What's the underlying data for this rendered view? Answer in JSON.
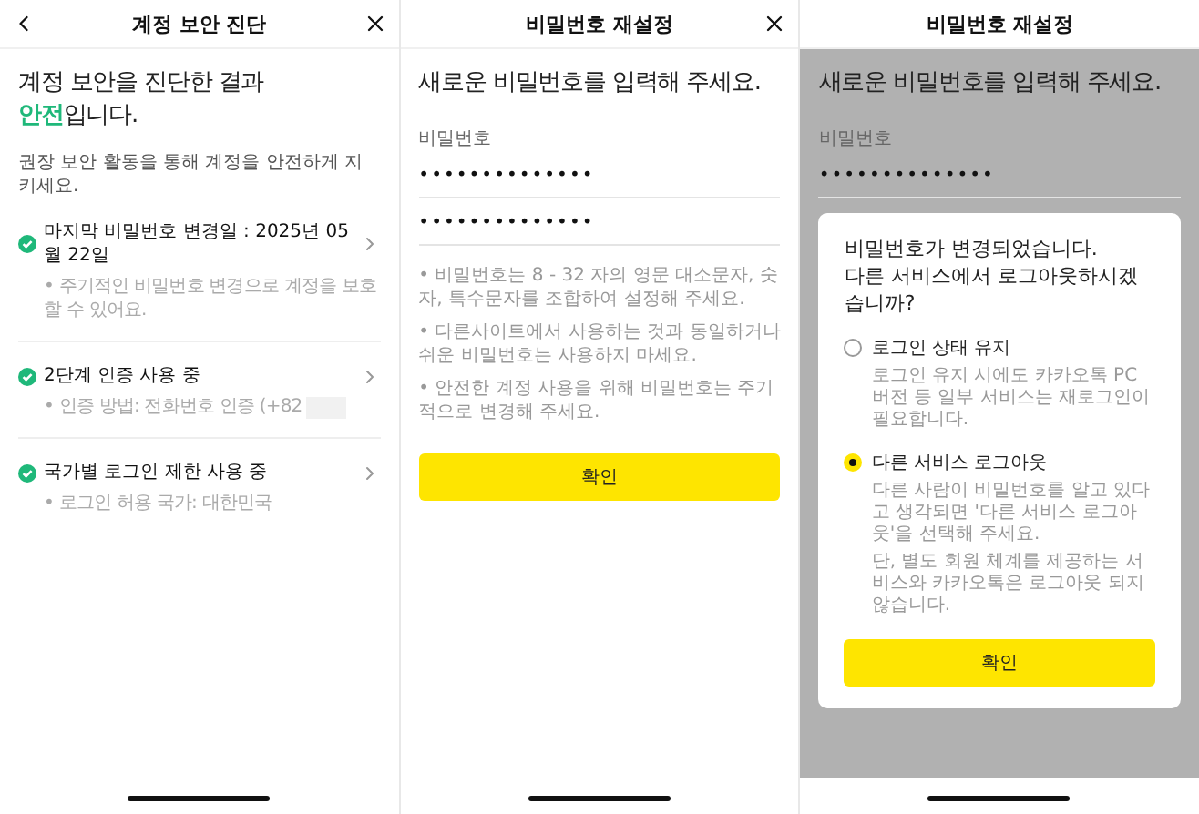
{
  "screens": [
    {
      "kind": "diagnosis",
      "title": "계정 보안 진단",
      "heading": "계정 보안을 진단한 결과",
      "result_word": "안전",
      "result_rest": "입니다.",
      "subtitle": "권장 보안 활동을 통해 계정을 안전하게 지키세요.",
      "items": [
        {
          "title": "마지막 비밀번호 변경일 : 2025년 05월 22일",
          "note": "• 주기적인 비밀번호 변경으로 계정을 보호할 수 있어요.",
          "redacted": false
        },
        {
          "title": "2단계 인증 사용 중",
          "note": "• 인증 방법: 전화번호 인증 (+82",
          "redacted": true
        },
        {
          "title": "국가별 로그인 제한 사용 중",
          "note": "• 로그인 허용 국가: 대한민국",
          "redacted": false
        }
      ]
    },
    {
      "kind": "reset",
      "title": "비밀번호 재설정",
      "heading": "새로운 비밀번호를 입력해 주세요.",
      "field_label": "비밀번호",
      "fields": [
        "••••••••••••••",
        "••••••••••••••"
      ],
      "notes": [
        "• 비밀번호는 8 - 32 자의 영문 대소문자, 숫자, 특수문자를 조합하여 설정해 주세요.",
        "• 다른사이트에서 사용하는 것과 동일하거나 쉬운 비밀번호는 사용하지 마세요.",
        "• 안전한 계정 사용을 위해 비밀번호는 주기적으로 변경해 주세요."
      ],
      "button": "확인"
    },
    {
      "kind": "reset_dialog",
      "title": "비밀번호 재설정",
      "heading": "새로운 비밀번호를 입력해 주세요.",
      "field_label": "비밀번호",
      "fields": [
        "••••••••••••••"
      ],
      "dialog": {
        "message": "비밀번호가 변경되었습니다.\n다른 서비스에서 로그아웃하시겠습니까?",
        "options": [
          {
            "label": "로그인 상태 유지",
            "selected": false,
            "description": [
              "로그인 유지 시에도 카카오톡 PC버전 등 일부 서비스는 재로그인이 필요합니다."
            ]
          },
          {
            "label": "다른 서비스 로그아웃",
            "selected": true,
            "description": [
              "다른 사람이 비밀번호를 알고 있다고 생각되면 '다른 서비스 로그아웃'을 선택해 주세요.",
              "단, 별도 회원 체계를 제공하는 서비스와 카카오톡은 로그아웃 되지 않습니다."
            ]
          }
        ],
        "button": "확인"
      }
    }
  ]
}
